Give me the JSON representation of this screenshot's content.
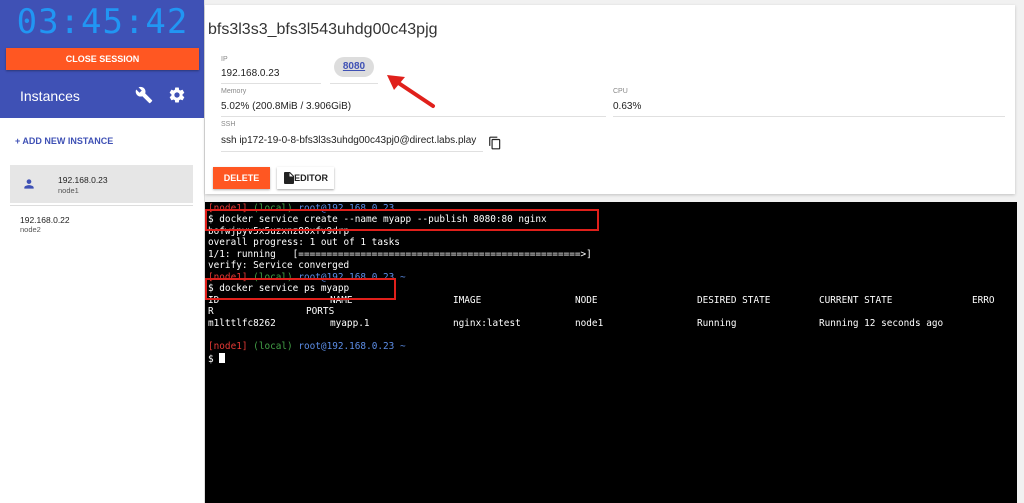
{
  "sidebar": {
    "timer": "03:45:42",
    "close_session": "CLOSE SESSION",
    "title": "Instances",
    "add_instance": "+ ADD NEW INSTANCE",
    "instances": [
      {
        "ip": "192.168.0.23",
        "name": "node1",
        "selected": true
      },
      {
        "ip": "192.168.0.22",
        "name": "node2",
        "selected": false
      }
    ],
    "icons": [
      "wrench-icon",
      "gear-icon",
      "person-icon"
    ]
  },
  "card": {
    "hostname": "bfs3l3s3_bfs3l543uhdg00c43pjg",
    "ip_label": "IP",
    "ip_value": "192.168.0.23",
    "port": "8080",
    "memory_label": "Memory",
    "memory_value": "5.02% (200.8MiB / 3.906GiB)",
    "cpu_label": "CPU",
    "cpu_value": "0.63%",
    "ssh_label": "SSH",
    "ssh_value": "ssh ip172-19-0-8-bfs3l3s3uhdg00c43pj0@direct.labs.play",
    "delete_label": "DELETE",
    "editor_label": "EDITOR",
    "icons": [
      "copy-icon",
      "file-icon"
    ]
  },
  "terminal": {
    "prompt_node": "[node1]",
    "prompt_local": "(local)",
    "prompt_root": "root@192.168.0.23",
    "prompt_tilde": "~",
    "cmd1": "$ docker service create --name myapp --publish 8080:80 nginx",
    "out_id": "bofwjpyv5x5uzxnz80xfv9drp",
    "out_progress": "overall progress: 1 out of 1 tasks",
    "out_running": "1/1: running   [==================================================>]",
    "out_verify": "verify: Service converged",
    "cmd2": "$ docker service ps myapp",
    "ps_headers": [
      "ID",
      "NAME",
      "IMAGE",
      "NODE",
      "DESIRED STATE",
      "CURRENT STATE",
      "ERRO"
    ],
    "ps_headers_wrap": "R",
    "ps_ports": "PORTS",
    "ps_row": [
      "m1lttlfc8262",
      "myapp.1",
      "nginx:latest",
      "node1",
      "Running",
      "Running 12 seconds ago"
    ],
    "final_prompt": "$"
  },
  "colors": {
    "indigo": "#3f51b5",
    "orange": "#ff5722",
    "timer_blue": "#2196f3",
    "annotation_red": "#e0201b",
    "prompt_red": "#e53935",
    "prompt_green": "#43a047",
    "prompt_blue": "#5c8de6"
  }
}
